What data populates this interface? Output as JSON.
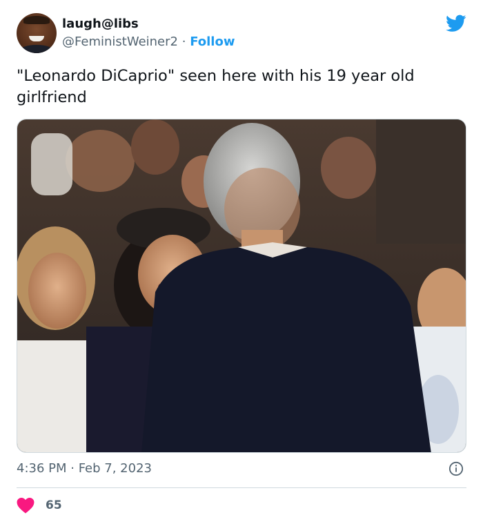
{
  "author": {
    "display_name": "laugh@libs",
    "handle": "@FeministWeiner2",
    "separator": "·",
    "follow_label": "Follow"
  },
  "tweet": {
    "text": "\"Leonardo DiCaprio\" seen here with his 19 year old girlfriend",
    "timestamp": "4:36 PM · Feb 7, 2023"
  },
  "engagement": {
    "likes": "65"
  },
  "icons": {
    "platform": "twitter-bird-icon",
    "info": "info-icon",
    "like": "heart-icon"
  },
  "colors": {
    "brand": "#1d9bf0",
    "like": "#f91880",
    "muted_text": "#536471"
  }
}
